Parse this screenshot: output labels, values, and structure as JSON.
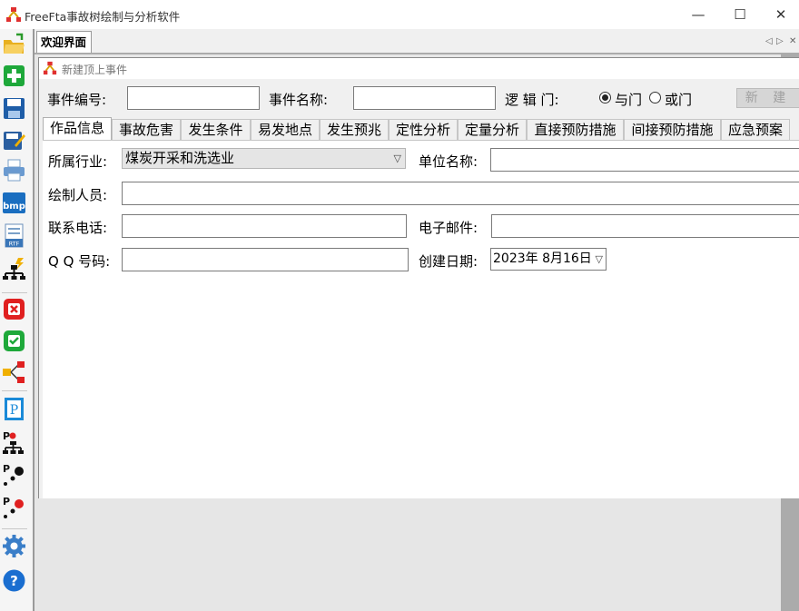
{
  "window": {
    "title": "FreeFta事故树绘制与分析软件",
    "minimize": "—",
    "maximize": "☐",
    "close": "✕"
  },
  "doc_tab": {
    "label": "欢迎界面",
    "nav_left": "◁",
    "nav_right": "▷",
    "nav_close": "✕"
  },
  "child": {
    "title": "新建顶上事件",
    "event_id_label": "事件编号:",
    "event_id_value": "",
    "event_name_label": "事件名称:",
    "event_name_value": "",
    "logic_gate_label": "逻 辑 门:",
    "gate_and": "与门",
    "gate_or": "或门",
    "gate_selected": "与门",
    "new_button": "新 建"
  },
  "tabs": [
    {
      "label": "作品信息",
      "active": true
    },
    {
      "label": "事故危害",
      "active": false
    },
    {
      "label": "发生条件",
      "active": false
    },
    {
      "label": "易发地点",
      "active": false
    },
    {
      "label": "发生预兆",
      "active": false
    },
    {
      "label": "定性分析",
      "active": false
    },
    {
      "label": "定量分析",
      "active": false
    },
    {
      "label": "直接预防措施",
      "active": false
    },
    {
      "label": "间接预防措施",
      "active": false
    },
    {
      "label": "应急预案",
      "active": false
    }
  ],
  "form": {
    "industry_label": "所属行业:",
    "industry_value": "煤炭开采和洗选业",
    "unit_label": "单位名称:",
    "unit_value": "",
    "author_label": "绘制人员:",
    "author_value": "",
    "phone_label": "联系电话:",
    "phone_value": "",
    "email_label": "电子邮件:",
    "email_value": "",
    "qq_label": "Q Q 号码:",
    "qq_value": "",
    "date_label": "创建日期:",
    "date_value": "2023年  8月16日"
  },
  "toolbar_icons": [
    "open-folder-icon",
    "add-icon",
    "save-icon",
    "edit-save-icon",
    "print-icon",
    "export-bmp-icon",
    "export-rtf-icon",
    "tree-generate-icon",
    "delete-icon",
    "verify-icon",
    "flow-icon",
    "document-icon",
    "p-tree-icon",
    "p-dots-icon",
    "p-dots-red-icon",
    "settings-icon",
    "help-icon"
  ]
}
